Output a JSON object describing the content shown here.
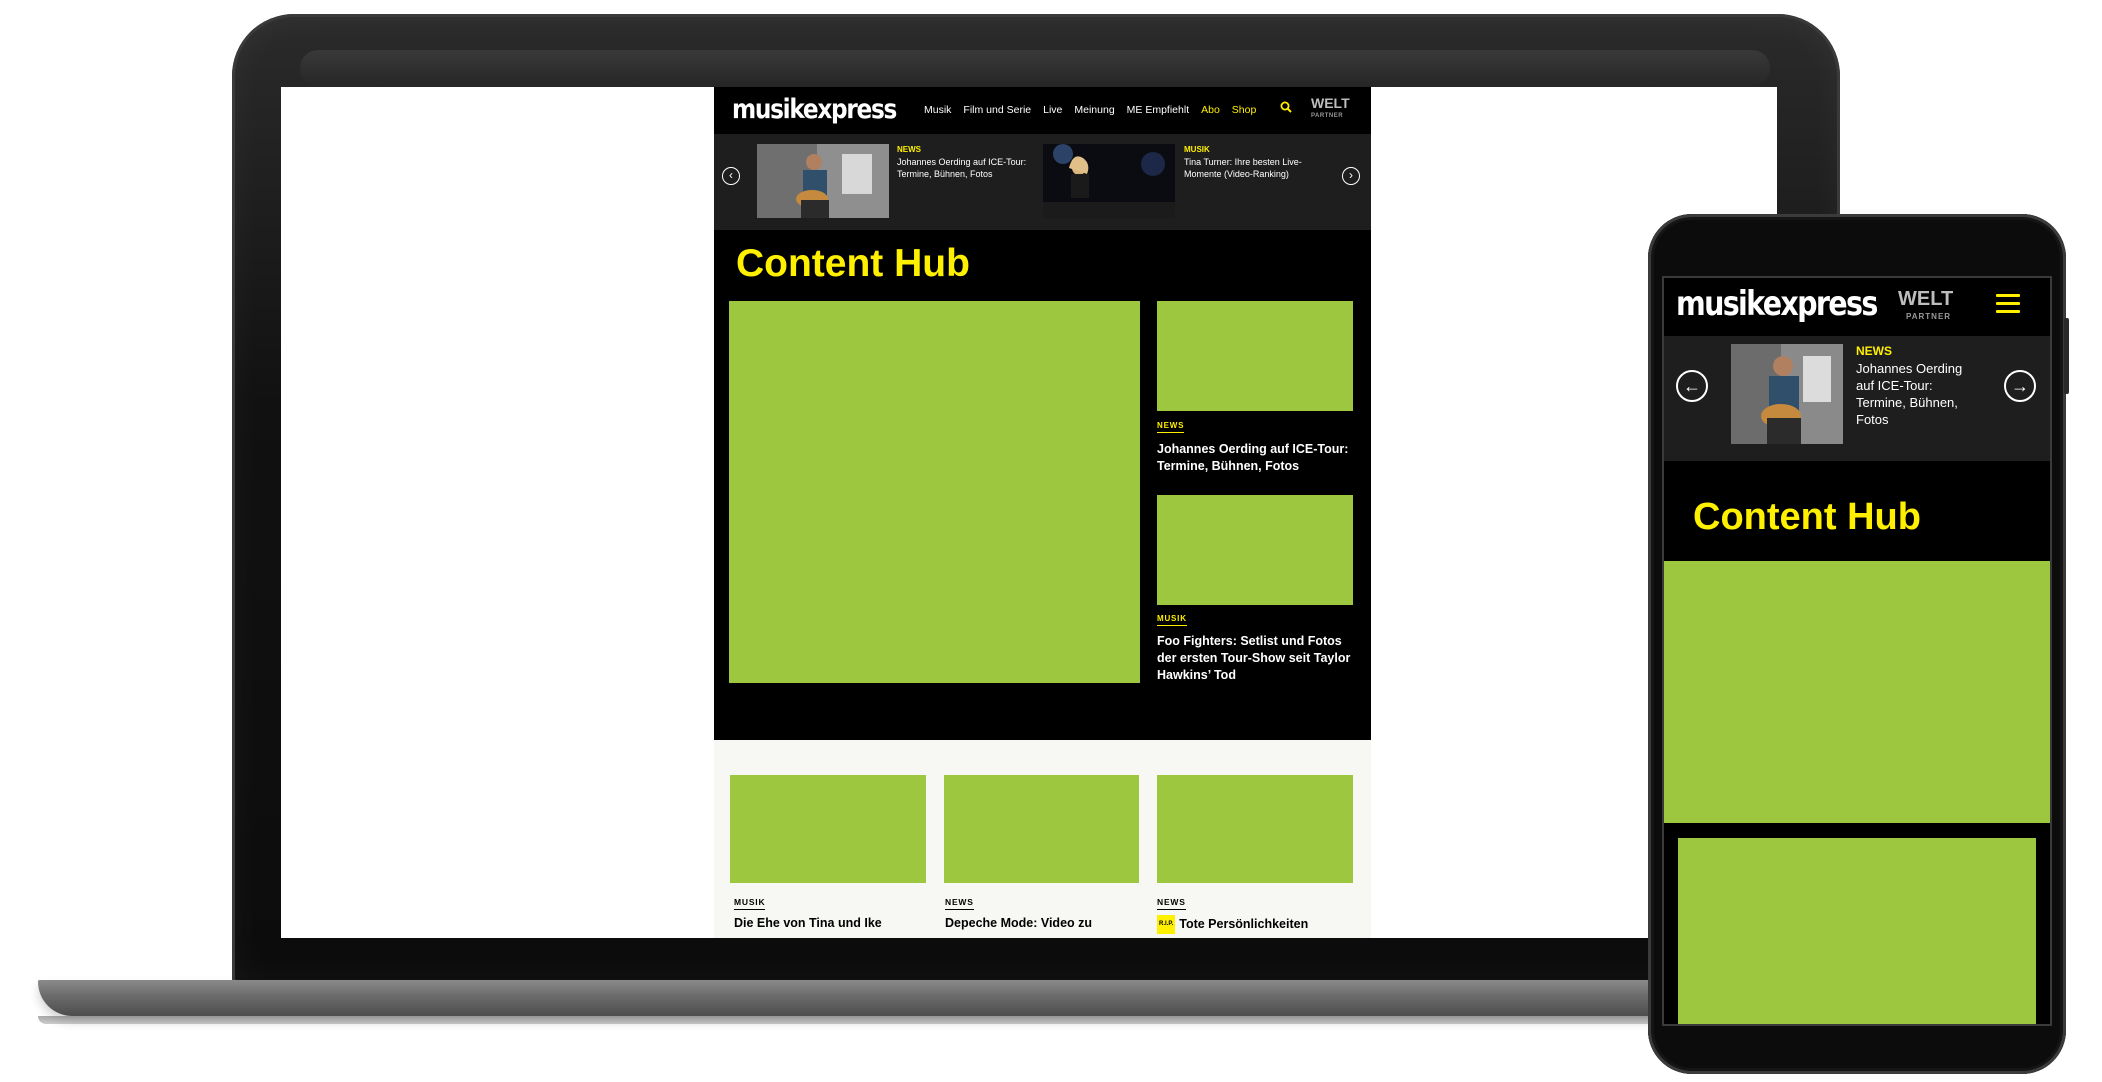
{
  "colors": {
    "accent_yellow": "#fff000",
    "placeholder_green": "#9dc73e",
    "background_black": "#000000"
  },
  "site": {
    "logo": "musikexpress",
    "nav": [
      "Musik",
      "Film und Serie",
      "Live",
      "Meinung",
      "ME Empfiehlt"
    ],
    "nav_highlight": [
      "Abo",
      "Shop"
    ],
    "partner_logo": "WELT",
    "partner_label": "PARTNER"
  },
  "ticker": [
    {
      "category": "NEWS",
      "title": "Johannes Oerding auf ICE-Tour: Termine, Bühnen, Fotos"
    },
    {
      "category": "MUSIK",
      "title": "Tina Turner: Ihre besten Live-Momente (Video-Ranking)"
    }
  ],
  "hub": {
    "title": "Content Hub",
    "side_articles": [
      {
        "category": "NEWS",
        "title": "Johannes Oerding auf ICE-Tour: Termine, Bühnen, Fotos"
      },
      {
        "category": "MUSIK",
        "title": "Foo Fighters: Setlist und Fotos der ersten Tour-Show seit Taylor Hawkins’ Tod"
      }
    ]
  },
  "bottom_articles": [
    {
      "category": "MUSIK",
      "title": "Die Ehe von Tina und Ike"
    },
    {
      "category": "NEWS",
      "title": "Depeche Mode: Video zu"
    },
    {
      "category": "NEWS",
      "badge": "R.I.P.",
      "title": "Tote Persönlichkeiten"
    }
  ],
  "mobile": {
    "logo": "musikexpress",
    "partner_logo": "WELT",
    "partner_label": "PARTNER",
    "ticker": {
      "category": "NEWS",
      "title": "Johannes Oerding auf ICE-Tour: Termine, Bühnen, Fotos"
    },
    "hub_title": "Content Hub"
  },
  "icons": [
    "search-icon",
    "arrow-left-icon",
    "arrow-right-icon",
    "hamburger-menu-icon"
  ]
}
